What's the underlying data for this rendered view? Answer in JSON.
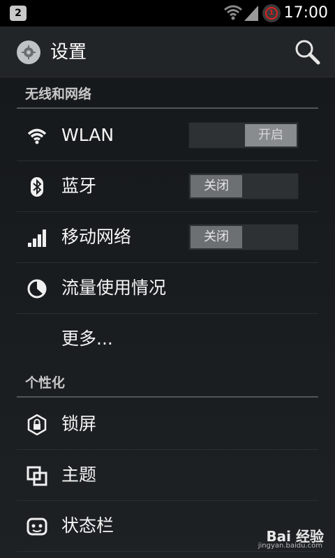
{
  "status_bar": {
    "notification_badge": "2",
    "record_badge": "1",
    "time": "17:00"
  },
  "action_bar": {
    "title": "设置",
    "search_icon": "search-icon",
    "app_icon": "settings-gear-icon"
  },
  "sections": [
    {
      "header": "无线和网络",
      "items": [
        {
          "icon": "wifi-icon",
          "label": "WLAN",
          "toggle": {
            "state": "on",
            "label": "开启"
          }
        },
        {
          "icon": "bluetooth-icon",
          "label": "蓝牙",
          "toggle": {
            "state": "off",
            "label": "关闭"
          }
        },
        {
          "icon": "signal-bars-icon",
          "label": "移动网络",
          "toggle": {
            "state": "off",
            "label": "关闭"
          }
        },
        {
          "icon": "data-usage-icon",
          "label": "流量使用情况"
        },
        {
          "icon": "",
          "label": "更多..."
        }
      ]
    },
    {
      "header": "个性化",
      "items": [
        {
          "icon": "lock-screen-icon",
          "label": "锁屏"
        },
        {
          "icon": "theme-icon",
          "label": "主题"
        },
        {
          "icon": "status-bar-icon",
          "label": "状态栏"
        }
      ]
    }
  ],
  "watermark": {
    "brand": "Bai 经验",
    "url": "jingyan.baidu.com"
  }
}
